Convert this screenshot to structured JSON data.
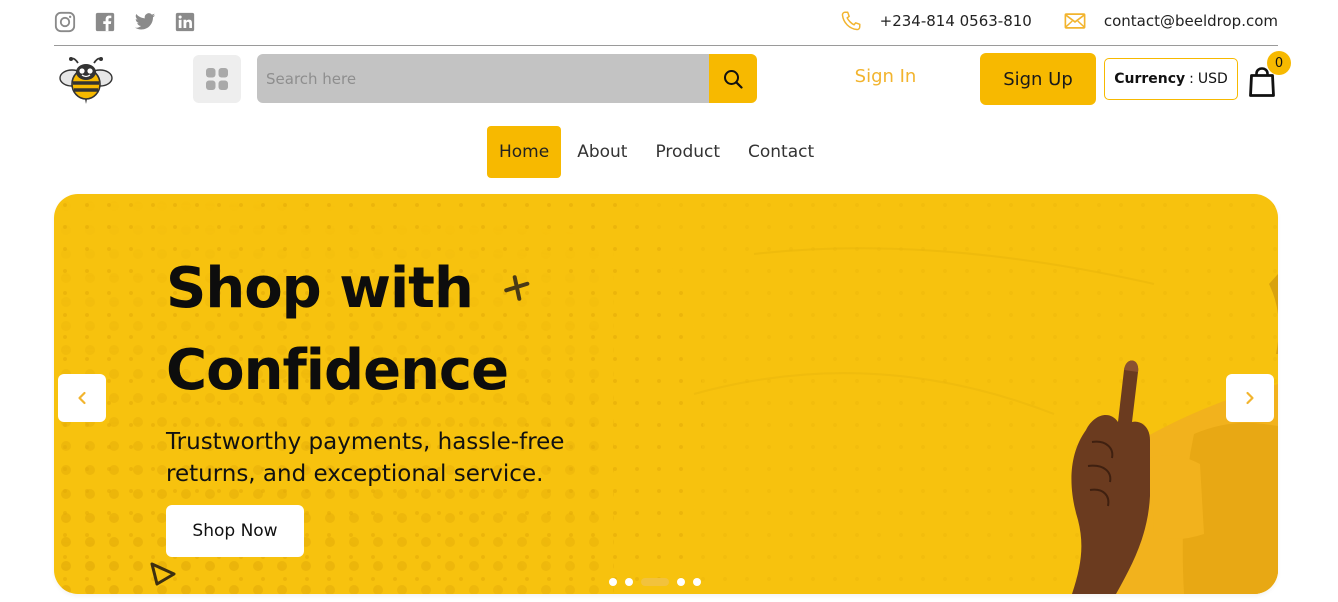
{
  "topbar": {
    "social": [
      {
        "icon": "instagram-icon"
      },
      {
        "icon": "facebook-icon"
      },
      {
        "icon": "twitter-icon"
      },
      {
        "icon": "linkedin-icon"
      }
    ],
    "phone": "+234-814 0563-810",
    "email": "contact@beeldrop.com"
  },
  "header": {
    "search_placeholder": "Search here",
    "sign_in": "Sign In",
    "sign_up": "Sign Up",
    "currency_label": "Currency",
    "currency_sep": ":",
    "currency_value": "USD",
    "cart_count": "0"
  },
  "nav": [
    {
      "label": "Home",
      "active": true
    },
    {
      "label": "About",
      "active": false
    },
    {
      "label": "Product",
      "active": false
    },
    {
      "label": "Contact",
      "active": false
    }
  ],
  "hero": {
    "title_line1": "Shop with",
    "title_line2": "Confidence",
    "subtitle": "Trustworthy payments, hassle-free returns, and exceptional service.",
    "cta": "Shop Now",
    "slide_count": 5,
    "active_slide": 3
  },
  "colors": {
    "accent": "#f7b900",
    "hero_bg": "#f7c20e",
    "sign_in_text": "#f2b42e"
  }
}
